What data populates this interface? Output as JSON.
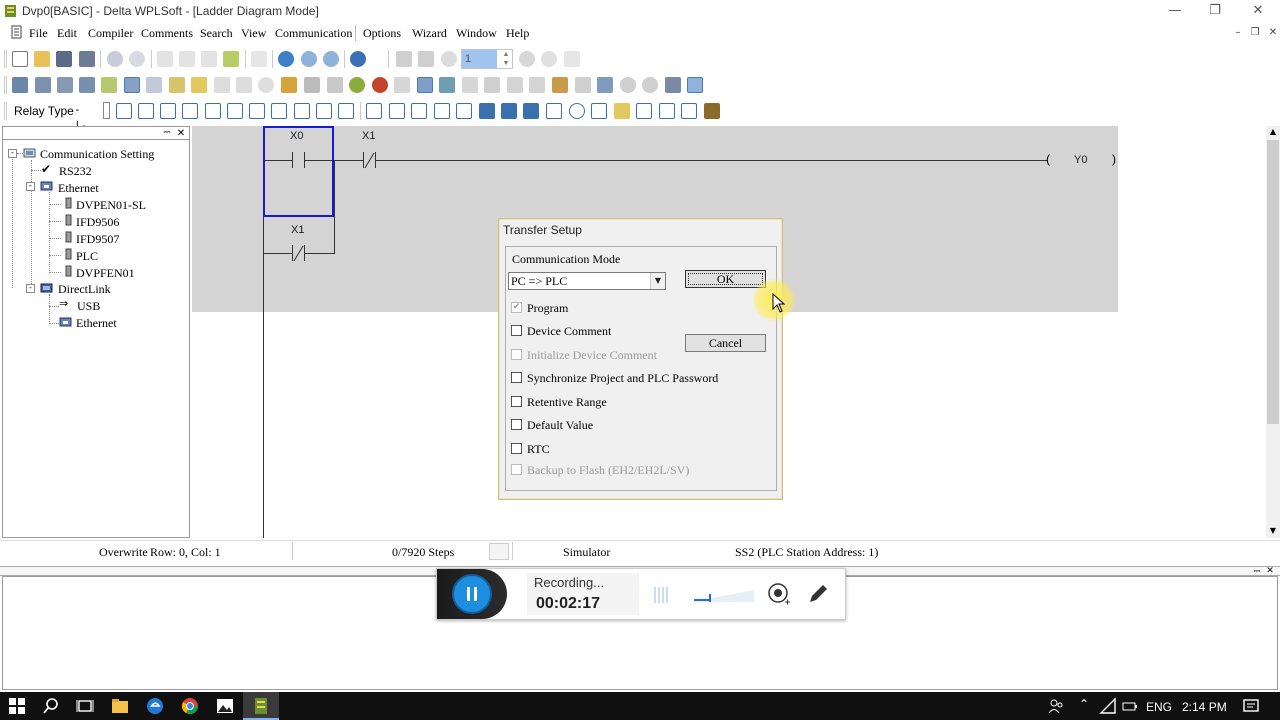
{
  "window": {
    "title": "Dvp0[BASIC] - Delta WPLSoft - [Ladder Diagram Mode]"
  },
  "menu": {
    "items": [
      "File",
      "Edit",
      "Compiler",
      "Comments",
      "Search",
      "View",
      "Communication",
      "Options",
      "Wizard",
      "Window",
      "Help"
    ]
  },
  "toolbar": {
    "relay_type_label": "Relay Type",
    "step_value": "1"
  },
  "tree": {
    "root": "Communication Setting",
    "rs232": "RS232",
    "ethernet": "Ethernet",
    "ethernet_children": [
      "DVPEN01-SL",
      "IFD9506",
      "IFD9507",
      "PLC",
      "DVPFEN01"
    ],
    "directlink": "DirectLink",
    "directlink_children": [
      "USB",
      "Ethernet"
    ]
  },
  "ladder": {
    "contact1": "X0",
    "contact2": "X1",
    "contact3": "X1",
    "coil": "Y0"
  },
  "status": {
    "mode": "Overwrite",
    "position": "Row: 0, Col: 1",
    "steps": "0/7920 Steps",
    "simulator": "Simulator",
    "station": "SS2 (PLC Station Address: 1)"
  },
  "dialog": {
    "title": "Transfer Setup",
    "group_label": "Communication Mode",
    "mode_value": "PC => PLC",
    "ok_label": "OK",
    "cancel_label": "Cancel",
    "options": [
      {
        "label": "Program",
        "checked": true,
        "enabled": false
      },
      {
        "label": "Device Comment",
        "checked": false,
        "enabled": true
      },
      {
        "label": "Initialize Device Comment",
        "checked": false,
        "enabled": false
      },
      {
        "label": "Synchronize Project and PLC Password",
        "checked": false,
        "enabled": true
      },
      {
        "label": "Retentive Range",
        "checked": false,
        "enabled": true
      },
      {
        "label": "Default Value",
        "checked": false,
        "enabled": true
      },
      {
        "label": "RTC",
        "checked": false,
        "enabled": true
      },
      {
        "label": "Backup to Flash (EH2/EH2L/SV)",
        "checked": false,
        "enabled": false
      }
    ]
  },
  "recorder": {
    "status": "Recording...",
    "elapsed": "00:02:17"
  },
  "taskbar": {
    "language": "ENG",
    "clock": "2:14 PM"
  },
  "colors": {
    "ladder_gray": "#d4d4d4",
    "cursor_blue": "#1a1ad0",
    "record_blue": "#1e8fe0",
    "taskbar": "#101010"
  }
}
